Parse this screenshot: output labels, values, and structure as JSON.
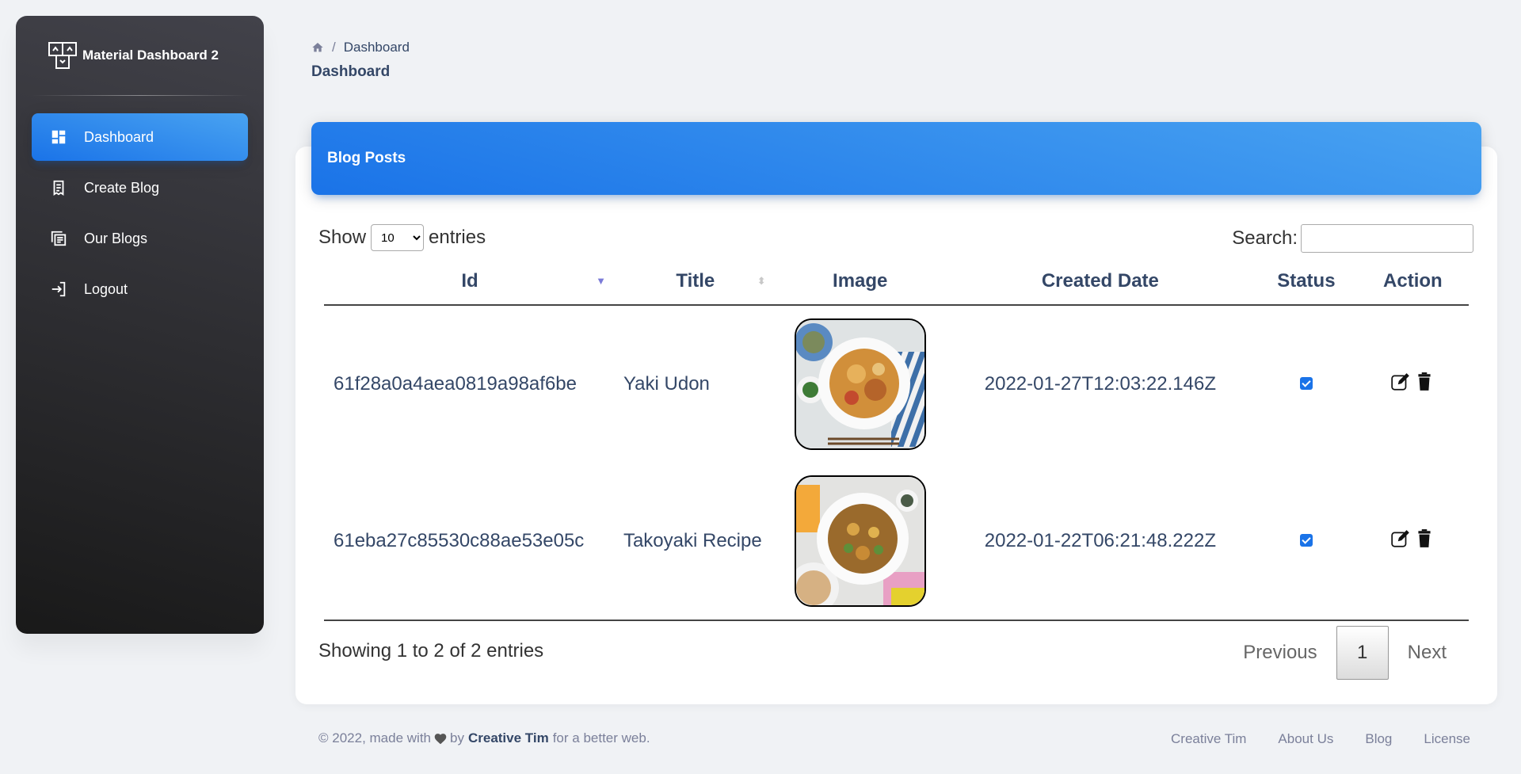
{
  "sidebar": {
    "brand": "Material Dashboard 2",
    "items": [
      {
        "label": "Dashboard",
        "icon": "dashboard-icon",
        "active": true
      },
      {
        "label": "Create Blog",
        "icon": "receipt-icon",
        "active": false
      },
      {
        "label": "Our Blogs",
        "icon": "library-icon",
        "active": false
      },
      {
        "label": "Logout",
        "icon": "login-icon",
        "active": false
      }
    ]
  },
  "breadcrumb": {
    "home_icon": "home-icon",
    "current": "Dashboard"
  },
  "page_title": "Dashboard",
  "card": {
    "title": "Blog Posts"
  },
  "table_controls": {
    "show_label": "Show",
    "entries_label": "entries",
    "page_size": "10",
    "search_label": "Search:",
    "search_value": ""
  },
  "table": {
    "columns": [
      "Id",
      "Title",
      "Image",
      "Created Date",
      "Status",
      "Action"
    ],
    "rows": [
      {
        "id": "61f28a0a4aea0819a98af6be",
        "title": "Yaki Udon",
        "created": "2022-01-27T12:03:22.146Z",
        "status": true
      },
      {
        "id": "61eba27c85530c88ae53e05c",
        "title": "Takoyaki Recipe",
        "created": "2022-01-22T06:21:48.222Z",
        "status": true
      }
    ]
  },
  "pagination": {
    "info": "Showing 1 to 2 of 2 entries",
    "previous": "Previous",
    "page": "1",
    "next": "Next"
  },
  "footer": {
    "prefix": "© 2022, made with",
    "by": "by",
    "author": "Creative Tim",
    "suffix": "for a better web.",
    "links": [
      "Creative Tim",
      "About Us",
      "Blog",
      "License"
    ]
  },
  "colors": {
    "accent": "#1A73E8",
    "sidebar_dark": "#191919",
    "text": "#344767"
  }
}
